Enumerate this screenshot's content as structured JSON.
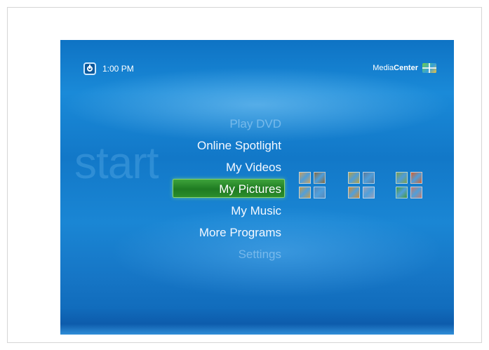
{
  "header": {
    "clock": "1:00 PM",
    "brand_light": "Media",
    "brand_bold": "Center"
  },
  "watermark": "start",
  "menu": {
    "items": [
      {
        "label": "Play DVD",
        "state": "faded"
      },
      {
        "label": "Online Spotlight",
        "state": "normal"
      },
      {
        "label": "My Videos",
        "state": "normal"
      },
      {
        "label": "My Pictures",
        "state": "selected"
      },
      {
        "label": "My Music",
        "state": "normal"
      },
      {
        "label": "More Programs",
        "state": "normal"
      },
      {
        "label": "Settings",
        "state": "faded"
      }
    ]
  },
  "thumbnails": {
    "groups": [
      {
        "name": "people",
        "colors": [
          "#c8a060",
          "#8a6a3c",
          "#c89a48",
          "#5a88b8"
        ]
      },
      {
        "name": "landscapes",
        "colors": [
          "#b8a040",
          "#5c7a9a",
          "#d88a28",
          "#9aa0b8"
        ]
      },
      {
        "name": "nature",
        "colors": [
          "#7ea04a",
          "#d8602a",
          "#4a9a3a",
          "#c87a6a"
        ]
      }
    ]
  },
  "colors": {
    "accent_selected": "#2a8d2b",
    "background_blue": "#1278c8"
  },
  "icons": {
    "power": "power-icon",
    "windows_logo": "windows-logo-icon"
  }
}
